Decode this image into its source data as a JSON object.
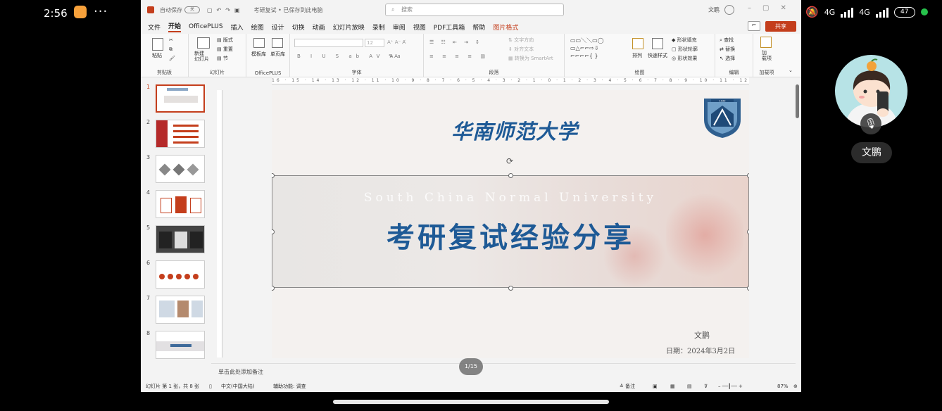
{
  "phone": {
    "time": "2:56",
    "more": "···",
    "net1": "4G",
    "net2": "4G",
    "battery": "47"
  },
  "call": {
    "participant_name": "文鹏"
  },
  "titlebar": {
    "autosave_label": "自动保存",
    "autosave_state": "关",
    "doc_title": "考研复试 • 已保存到此电脑",
    "search_placeholder": "搜索",
    "user_name": "文鹏"
  },
  "menu": {
    "tabs": [
      "文件",
      "开始",
      "OfficePLUS",
      "插入",
      "绘图",
      "设计",
      "切换",
      "动画",
      "幻灯片放映",
      "录制",
      "审阅",
      "视图",
      "PDF工具箱",
      "帮助",
      "图片格式"
    ],
    "comment": "⌐",
    "share": "共享"
  },
  "ribbon": {
    "groups": [
      "剪贴板",
      "幻灯片",
      "OfficePLUS",
      "字体",
      "段落",
      "绘图",
      "编辑",
      "加载项"
    ],
    "paste": "粘贴",
    "new_slide": "新建\n幻灯片",
    "layout": "版式",
    "reset": "重置",
    "section": "节",
    "template_lib": "模板库",
    "single_lib": "单页库",
    "font_size": "12",
    "text_direction": "文字方向",
    "align_text": "对齐文本",
    "convert_smartart": "转换为 SmartArt",
    "arrange": "排列",
    "quick_styles": "快速样式",
    "shape_fill": "形状填充",
    "shape_outline": "形状轮廓",
    "shape_effects": "形状效果",
    "find": "查找",
    "replace": "替换",
    "select": "选择",
    "addins": "加\n载项"
  },
  "thumbnails": [
    "1",
    "2",
    "3",
    "4",
    "5",
    "6",
    "7",
    "8"
  ],
  "ruler": {
    "marks": "16 · 15 · 14 · 13 · 12 · 11 · 10 · 9 · 8 · 7 · 6 · 5 · 4 · 3 · 2 · 1 · 0 · 1 · 2 · 3 · 4 · 5 · 6 · 7 · 8 · 9 · 10 · 11 · 12 · 13 · 14 · 15 · 16"
  },
  "slide": {
    "university_cn": "华南师范大学",
    "university_en": "South China Normal University",
    "title": "考研复试经验分享",
    "author": "文鹏",
    "date": "日期：2024年3月2日",
    "emblem_year": "1933",
    "emblem_text": "华南师范大学",
    "colors": {
      "title": "#1e5a96",
      "accent": "#c43e1c"
    }
  },
  "notes_placeholder": "单击此处添加备注",
  "page_indicator": "1/15",
  "status": {
    "slide_info": "幻灯片 第 1 张，共 8 张",
    "language": "中文(中国大陆)",
    "accessibility": "辅助功能: 调查",
    "notes": "备注",
    "zoom": "87%"
  }
}
